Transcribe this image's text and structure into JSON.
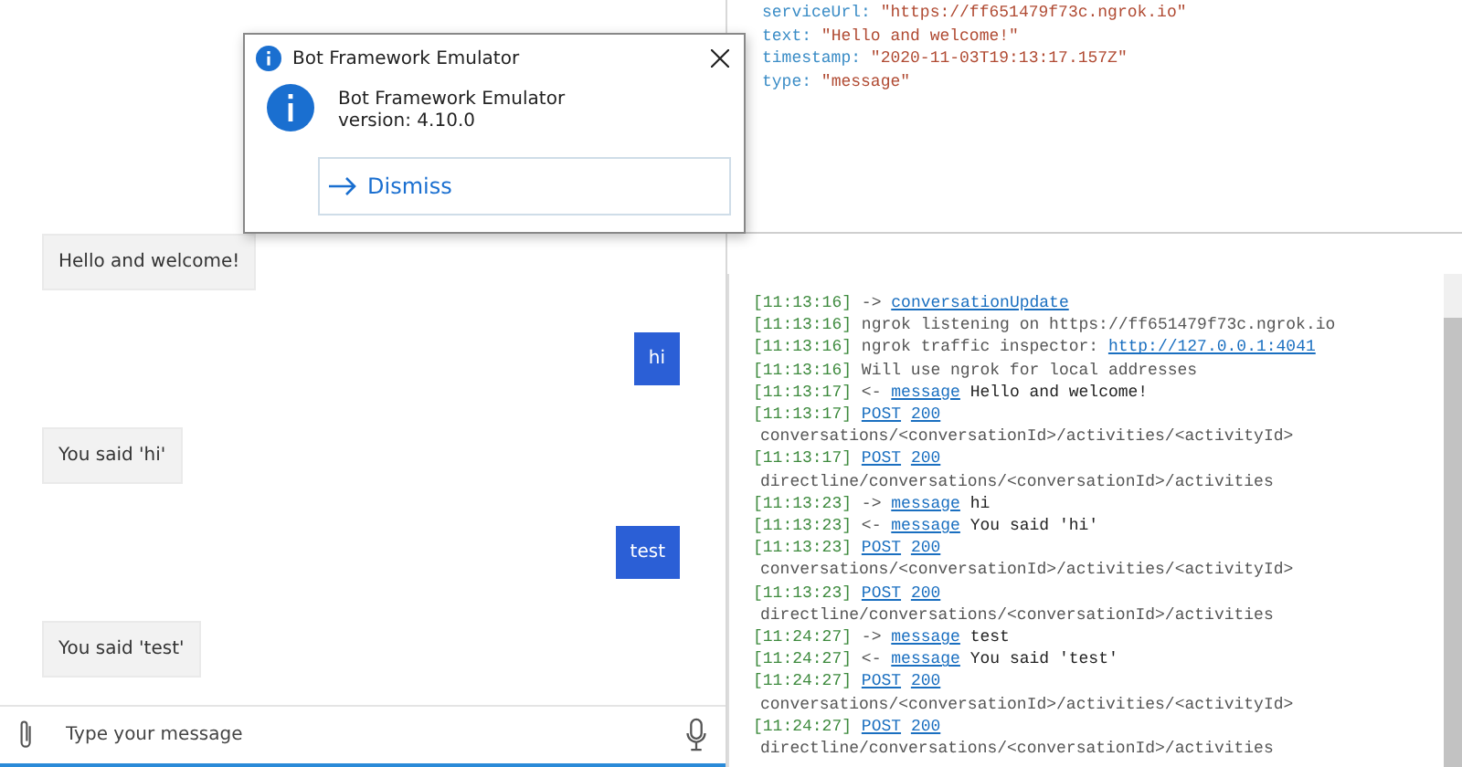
{
  "inspector": {
    "lines": [
      {
        "key": "serviceUrl:",
        "value": "\"https://ff651479f73c.ngrok.io\""
      },
      {
        "key": "text:",
        "value": "\"Hello and welcome!\""
      },
      {
        "key": "timestamp:",
        "value": "\"2020-11-03T19:13:17.157Z\""
      },
      {
        "key": "type:",
        "value": "\"message\""
      }
    ]
  },
  "dialog": {
    "title": "Bot Framework Emulator",
    "heading": "Bot Framework Emulator",
    "version": "version: 4.10.0",
    "button": "Dismiss"
  },
  "chat": {
    "messages": [
      {
        "kind": "bot",
        "text": "Hello and welcome!"
      },
      {
        "kind": "user",
        "text": "hi"
      },
      {
        "kind": "bot",
        "text": "You said 'hi'"
      },
      {
        "kind": "user",
        "text": "test"
      },
      {
        "kind": "bot",
        "text": "You said 'test'"
      }
    ],
    "input": {
      "placeholder": "Type your message"
    }
  },
  "log": [
    {
      "time": "[11:13:16]",
      "parts": [
        {
          "text": "->",
          "kind": "plain"
        },
        {
          "text": "conversationUpdate",
          "kind": "link"
        }
      ]
    },
    {
      "time": "[11:13:16]",
      "parts": [
        {
          "text": "ngrok listening on https://ff651479f73c.ngrok.io",
          "kind": "plain"
        }
      ]
    },
    {
      "time": "[11:13:16]",
      "parts": [
        {
          "text": "ngrok traffic inspector:",
          "kind": "plain"
        },
        {
          "text": "http://127.0.0.1:4041",
          "kind": "link"
        }
      ]
    },
    {
      "time": "[11:13:16]",
      "parts": [
        {
          "text": "Will use ngrok for local addresses",
          "kind": "plain"
        }
      ]
    },
    {
      "time": "[11:13:17]",
      "parts": [
        {
          "text": "<-",
          "kind": "plain"
        },
        {
          "text": "message",
          "kind": "link"
        },
        {
          "text": "Hello and welcome!",
          "kind": "content"
        }
      ]
    },
    {
      "time": "[11:13:17]",
      "parts": [
        {
          "text": "POST",
          "kind": "link"
        },
        {
          "text": "200",
          "kind": "link"
        }
      ],
      "path": "conversations/<conversationId>/activities/<activityId>"
    },
    {
      "time": "[11:13:17]",
      "parts": [
        {
          "text": "POST",
          "kind": "link"
        },
        {
          "text": "200",
          "kind": "link"
        }
      ],
      "path": "directline/conversations/<conversationId>/activities"
    },
    {
      "time": "[11:13:23]",
      "parts": [
        {
          "text": "->",
          "kind": "plain"
        },
        {
          "text": "message",
          "kind": "link"
        },
        {
          "text": "hi",
          "kind": "content"
        }
      ]
    },
    {
      "time": "[11:13:23]",
      "parts": [
        {
          "text": "<-",
          "kind": "plain"
        },
        {
          "text": "message",
          "kind": "link"
        },
        {
          "text": "You said 'hi'",
          "kind": "content"
        }
      ]
    },
    {
      "time": "[11:13:23]",
      "parts": [
        {
          "text": "POST",
          "kind": "link"
        },
        {
          "text": "200",
          "kind": "link"
        }
      ],
      "path": "conversations/<conversationId>/activities/<activityId>"
    },
    {
      "time": "[11:13:23]",
      "parts": [
        {
          "text": "POST",
          "kind": "link"
        },
        {
          "text": "200",
          "kind": "link"
        }
      ],
      "path": "directline/conversations/<conversationId>/activities"
    },
    {
      "time": "[11:24:27]",
      "parts": [
        {
          "text": "->",
          "kind": "plain"
        },
        {
          "text": "message",
          "kind": "link"
        },
        {
          "text": "test",
          "kind": "content"
        }
      ]
    },
    {
      "time": "[11:24:27]",
      "parts": [
        {
          "text": "<-",
          "kind": "plain"
        },
        {
          "text": "message",
          "kind": "link"
        },
        {
          "text": "You said 'test'",
          "kind": "content"
        }
      ]
    },
    {
      "time": "[11:24:27]",
      "parts": [
        {
          "text": "POST",
          "kind": "link"
        },
        {
          "text": "200",
          "kind": "link"
        }
      ],
      "path": "conversations/<conversationId>/activities/<activityId>"
    },
    {
      "time": "[11:24:27]",
      "parts": [
        {
          "text": "POST",
          "kind": "link"
        },
        {
          "text": "200",
          "kind": "link"
        }
      ],
      "path": "directline/conversations/<conversationId>/activities"
    }
  ]
}
